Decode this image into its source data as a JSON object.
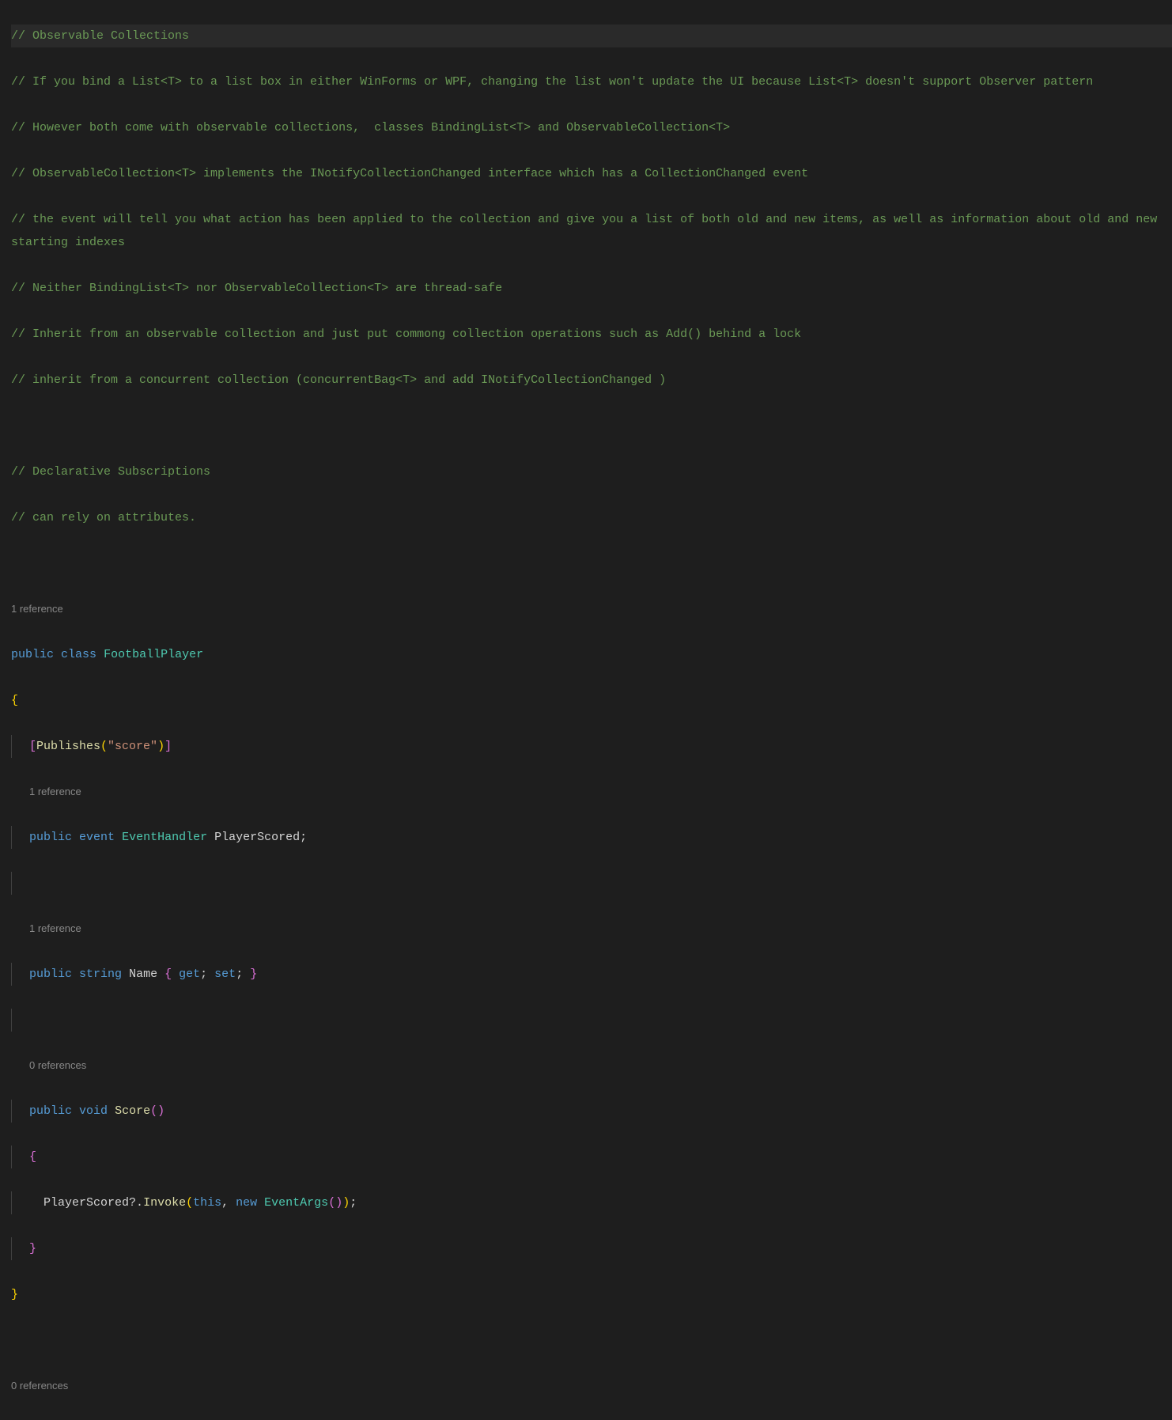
{
  "code": {
    "comment_line1": "// Observable Collections",
    "comment_line2": "// If you bind a List<T> to a list box in either WinForms or WPF, changing the list won't update the UI because List<T> doesn't support Observer pattern",
    "comment_line3": "// However both come with observable collections,  classes BindingList<T> and ObservableCollection<T>",
    "comment_line4": "// ObservableCollection<T> implements the INotifyCollectionChanged interface which has a CollectionChanged event",
    "comment_line5": "// the event will tell you what action has been applied to the collection and give you a list of both old and new items, as well as information about old and new starting indexes",
    "comment_line6": "// Neither BindingList<T> nor ObservableCollection<T> are thread-safe",
    "comment_line7": "// Inherit from an observable collection and just put commong collection operations such as Add() behind a lock",
    "comment_line8": "// inherit from a concurrent collection (concurrentBag<T> and add INotifyCollectionChanged )",
    "comment_line9": "// Declarative Subscriptions",
    "comment_line10": "// can rely on attributes.",
    "codelens1": "1 reference",
    "kw_public": "public",
    "kw_class": "class",
    "type_FootballPlayer": "FootballPlayer",
    "brace_open": "{",
    "brace_close": "}",
    "bracket_open": "[",
    "method_Publishes": "Publishes",
    "paren_open": "(",
    "string_score": "\"score\"",
    "paren_close": ")",
    "bracket_close": "]",
    "codelens2": "1 reference",
    "kw_event": "event",
    "type_EventHandler": "EventHandler",
    "id_PlayerScored": "PlayerScored",
    "semi": ";",
    "codelens3": "1 reference",
    "kw_string": "string",
    "id_Name": "Name",
    "kw_get": "get",
    "kw_set": "set",
    "codelens4": "0 references",
    "kw_void": "void",
    "method_Score": "Score",
    "id_PlayerScored_call": "PlayerScored?",
    "dot": ".",
    "method_Invoke": "Invoke",
    "kw_this": "this",
    "comma": ",",
    "kw_new": "new",
    "type_EventArgs": "EventArgs",
    "empty_parens": "()",
    "codelens5": "0 references"
  }
}
